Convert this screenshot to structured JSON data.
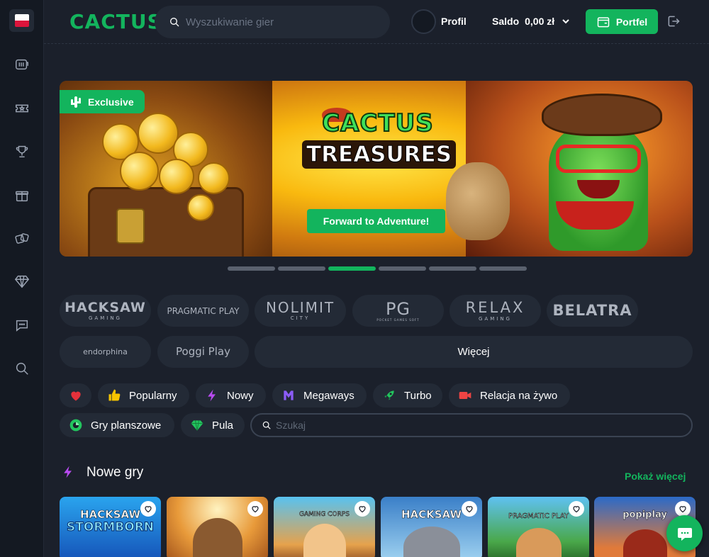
{
  "brand": {
    "logo": "CACTUS",
    "accent": "#13b45d"
  },
  "sidebar": {
    "language_flag": "Polish flag",
    "items": [
      {
        "icon": "slot-machine-icon",
        "label": "Slots"
      },
      {
        "icon": "ticket-icon",
        "label": "Tickets"
      },
      {
        "icon": "trophy-icon",
        "label": "Tournaments"
      },
      {
        "icon": "gift-icon",
        "label": "Promotions"
      },
      {
        "icon": "dice-icon",
        "label": "Table games"
      },
      {
        "icon": "diamond-icon",
        "label": "VIP"
      },
      {
        "icon": "chat-icon",
        "label": "Chat"
      },
      {
        "icon": "search-icon",
        "label": "Search"
      }
    ]
  },
  "header": {
    "search_placeholder": "Wyszukiwanie gier",
    "profile_label": "Profil",
    "balance_label": "Saldo",
    "balance_value": "0,00 zł",
    "wallet_button": "Portfel"
  },
  "banner": {
    "badge": "Exclusive",
    "title_line1": "CACTUS",
    "title_line2": "TREASURES",
    "cta": "Forward to Adventure!",
    "slides_count": 6,
    "active_slide": 3
  },
  "providers": {
    "items": [
      {
        "name": "HACKSAW",
        "sub": "GAMING"
      },
      {
        "name": "PRAGMATIC PLAY",
        "sub": ""
      },
      {
        "name": "NOLIMIT",
        "sub": "CITY"
      },
      {
        "name": "PG",
        "sub": "POCKET GAMES SOFT"
      },
      {
        "name": "RELAX",
        "sub": "GAMING"
      },
      {
        "name": "BELATRA",
        "sub": ""
      },
      {
        "name": "endorphina",
        "sub": ""
      },
      {
        "name": "Poggi Play",
        "sub": ""
      }
    ],
    "more_label": "Więcej"
  },
  "categories": {
    "favorites_icon": "heart-icon",
    "items": [
      {
        "label": "Popularny",
        "icon": "thumbs-up-icon"
      },
      {
        "label": "Nowy",
        "icon": "lightning-icon"
      },
      {
        "label": "Megaways",
        "icon": "megaways-icon"
      },
      {
        "label": "Turbo",
        "icon": "rocket-icon"
      },
      {
        "label": "Relacja na żywo",
        "icon": "live-camera-icon"
      },
      {
        "label": "Gry planszowe",
        "icon": "board-games-icon"
      },
      {
        "label": "Pula",
        "icon": "jackpot-gem-icon"
      }
    ],
    "search_placeholder": "Szukaj"
  },
  "new_games": {
    "title": "Nowe gry",
    "show_more": "Pokaż więcej",
    "games": [
      {
        "provider": "HACKSAW",
        "name": "STORMBORN"
      },
      {
        "provider": "",
        "name": ""
      },
      {
        "provider": "GAMING CORPS",
        "name": ""
      },
      {
        "provider": "HACKSAW",
        "name": ""
      },
      {
        "provider": "PRAGMATIC PLAY",
        "name": ""
      },
      {
        "provider": "popiplay",
        "name": ""
      }
    ]
  }
}
